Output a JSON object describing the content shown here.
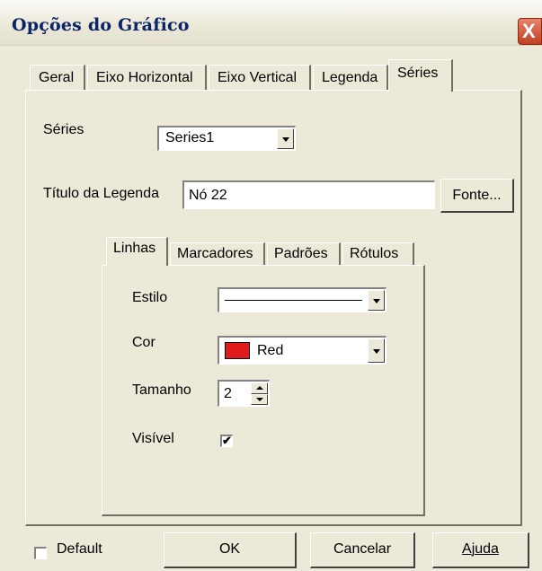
{
  "window": {
    "title": "Opções do Gráfico",
    "close_glyph": "X"
  },
  "tabs": [
    "Geral",
    "Eixo Horizontal",
    "Eixo Vertical",
    "Legenda",
    "Séries"
  ],
  "series": {
    "label": "Séries",
    "selected": "Series1",
    "legend_title_label": "Título da Legenda",
    "legend_title_value": "Nó 22",
    "font_button": "Fonte..."
  },
  "subtabs": [
    "Linhas",
    "Marcadores",
    "Padrões",
    "Rótulos"
  ],
  "lines": {
    "style_label": "Estilo",
    "color_label": "Cor",
    "color_value": "Red",
    "color_swatch": "#e01b1b",
    "size_label": "Tamanho",
    "size_value": "2",
    "visible_label": "Visível",
    "visible_checked": true
  },
  "footer": {
    "default_label": "Default",
    "default_checked": false,
    "ok": "OK",
    "cancel": "Cancelar",
    "help": "Ajuda"
  }
}
